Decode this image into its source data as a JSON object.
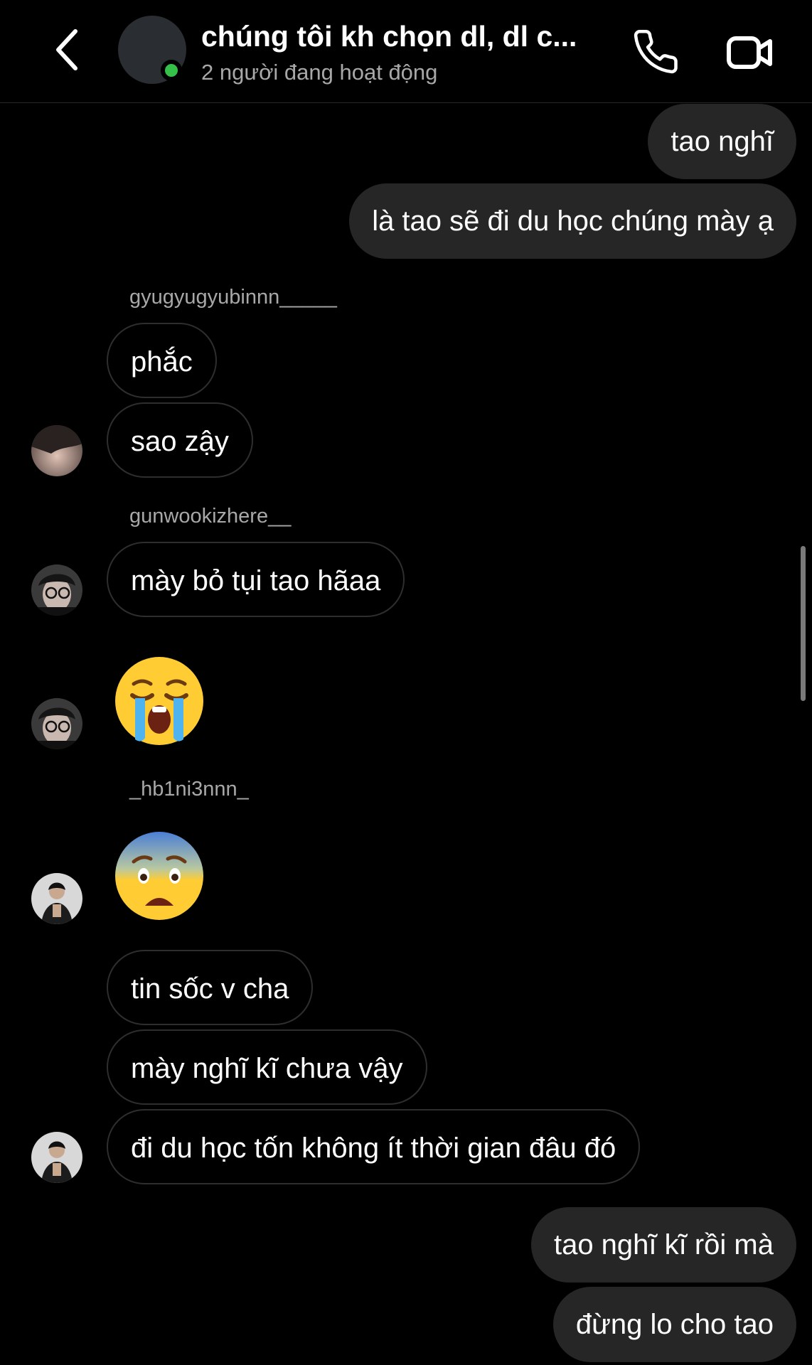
{
  "header": {
    "title": "chúng tôi kh chọn dl, dl c...",
    "status": "2 người đang hoạt động",
    "icons": [
      "chevron-left-icon",
      "phone-icon",
      "video-camera-icon"
    ]
  },
  "messages": {
    "m1": "tao nghĩ",
    "m2": "là tao sẽ đi du học chúng mày ạ",
    "sender1": "gyugyugyubinnn_____",
    "m3": "phắc",
    "m4": "sao zậy",
    "sender2": "gunwookizhere__",
    "m5": "mày bỏ tụi tao hãaa",
    "emoji1": "loudly-crying-face",
    "sender3": "_hb1ni3nnn_",
    "emoji2": "anxious-face",
    "m6": "tin sốc v cha",
    "m7": "mày nghĩ kĩ chưa vậy",
    "m8": "đi du học tốn không ít thời gian đâu đó",
    "m9": "tao nghĩ kĩ rồi mà",
    "m10": "đừng lo cho tao"
  },
  "colors": {
    "background": "#000000",
    "sent_bubble": "#262626",
    "received_border": "#2e2e2e",
    "online_dot": "#35c04a",
    "secondary_text": "#a8a8a8"
  }
}
